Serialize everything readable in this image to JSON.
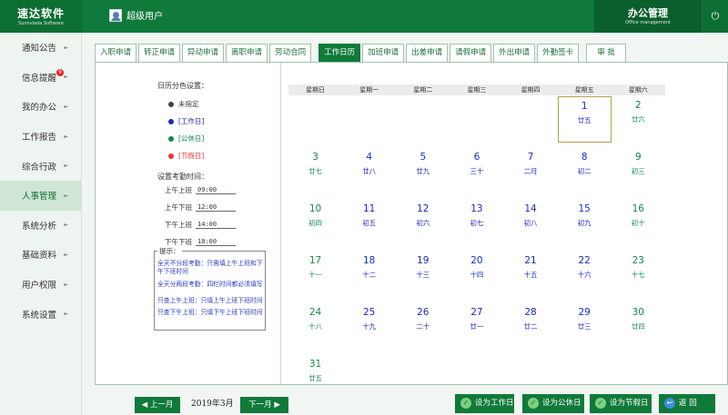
{
  "header": {
    "logo_main": "速达软件",
    "logo_sub": "Sunnvlada Software",
    "user": "超级用户",
    "module": "办公管理",
    "module_sub": "Office management",
    "power_icon": "power-icon"
  },
  "sidebar": {
    "items": [
      {
        "label": "通知公告"
      },
      {
        "label": "信息提醒",
        "badge": "9"
      },
      {
        "label": "我的办公"
      },
      {
        "label": "工作报告"
      },
      {
        "label": "综合行政"
      },
      {
        "label": "人事管理",
        "active": true
      },
      {
        "label": "系统分析"
      },
      {
        "label": "基础资料"
      },
      {
        "label": "用户权限"
      },
      {
        "label": "系统设置"
      }
    ]
  },
  "tabs": [
    {
      "label": "入职申请"
    },
    {
      "label": "转正申请"
    },
    {
      "label": "异动申请"
    },
    {
      "label": "离职申请"
    },
    {
      "label": "劳动合同"
    },
    {
      "label": "工作日历",
      "active": true
    },
    {
      "label": "加班申请"
    },
    {
      "label": "出差申请"
    },
    {
      "label": "请假申请"
    },
    {
      "label": "外出申请"
    },
    {
      "label": "外勤签卡"
    },
    {
      "label": "审  批"
    }
  ],
  "settings": {
    "color_title": "日历分色设置：",
    "legend": [
      {
        "label": "未指定",
        "color": "#444444"
      },
      {
        "label": "[工作日]",
        "color": "#1a2ac2"
      },
      {
        "label": "[公休日]",
        "color": "#13884a"
      },
      {
        "label": "[节假日]",
        "color": "#e23b3b"
      }
    ],
    "time_title": "设置考勤时间：",
    "times": [
      {
        "label": "上午上班",
        "value": "09:00"
      },
      {
        "label": "上午下班",
        "value": "12:00"
      },
      {
        "label": "下午上班",
        "value": "14:00"
      },
      {
        "label": "下午下班",
        "value": "18:00"
      }
    ],
    "tips_title": "提示：",
    "tips": [
      "全天不分段考勤：只需填上午上班和下午下班时间",
      "全天分两段考勤：四栏时间都必须填写",
      "只查上午上班：只填上午上班下班时间",
      "只查下午上班：只填下午上班下班时间"
    ]
  },
  "calendar": {
    "weekdays": [
      "星期日",
      "星期一",
      "星期二",
      "星期三",
      "星期四",
      "星期五",
      "星期六"
    ],
    "rows": [
      [
        null,
        null,
        null,
        null,
        null,
        {
          "d": "1",
          "l": "廿五",
          "t": "work",
          "today": true
        },
        {
          "d": "2",
          "l": "廿六",
          "t": "rest"
        }
      ],
      [
        {
          "d": "3",
          "l": "廿七",
          "t": "rest"
        },
        {
          "d": "4",
          "l": "廿八",
          "t": "work"
        },
        {
          "d": "5",
          "l": "廿九",
          "t": "work"
        },
        {
          "d": "6",
          "l": "三十",
          "t": "work"
        },
        {
          "d": "7",
          "l": "二月",
          "t": "work"
        },
        {
          "d": "8",
          "l": "初二",
          "t": "work"
        },
        {
          "d": "9",
          "l": "初三",
          "t": "rest"
        }
      ],
      [
        {
          "d": "10",
          "l": "初四",
          "t": "rest"
        },
        {
          "d": "11",
          "l": "初五",
          "t": "work"
        },
        {
          "d": "12",
          "l": "初六",
          "t": "work"
        },
        {
          "d": "13",
          "l": "初七",
          "t": "work"
        },
        {
          "d": "14",
          "l": "初八",
          "t": "work"
        },
        {
          "d": "15",
          "l": "初九",
          "t": "work"
        },
        {
          "d": "16",
          "l": "初十",
          "t": "rest"
        }
      ],
      [
        {
          "d": "17",
          "l": "十一",
          "t": "rest"
        },
        {
          "d": "18",
          "l": "十二",
          "t": "work"
        },
        {
          "d": "19",
          "l": "十三",
          "t": "work"
        },
        {
          "d": "20",
          "l": "十四",
          "t": "work"
        },
        {
          "d": "21",
          "l": "十五",
          "t": "work"
        },
        {
          "d": "22",
          "l": "十六",
          "t": "work"
        },
        {
          "d": "23",
          "l": "十七",
          "t": "rest"
        }
      ],
      [
        {
          "d": "24",
          "l": "十八",
          "t": "rest"
        },
        {
          "d": "25",
          "l": "十九",
          "t": "work"
        },
        {
          "d": "26",
          "l": "二十",
          "t": "work"
        },
        {
          "d": "27",
          "l": "廿一",
          "t": "work"
        },
        {
          "d": "28",
          "l": "廿二",
          "t": "work"
        },
        {
          "d": "29",
          "l": "廿三",
          "t": "work"
        },
        {
          "d": "30",
          "l": "廿四",
          "t": "rest"
        }
      ],
      [
        {
          "d": "31",
          "l": "廿五",
          "t": "rest"
        },
        null,
        null,
        null,
        null,
        null,
        null
      ]
    ]
  },
  "bottom": {
    "prev": "上一月",
    "month": "2019年3月",
    "next": "下一月",
    "set_work": "设为工作日",
    "set_rest": "设为公休日",
    "set_holiday": "设为节假日",
    "back": "返 回"
  }
}
